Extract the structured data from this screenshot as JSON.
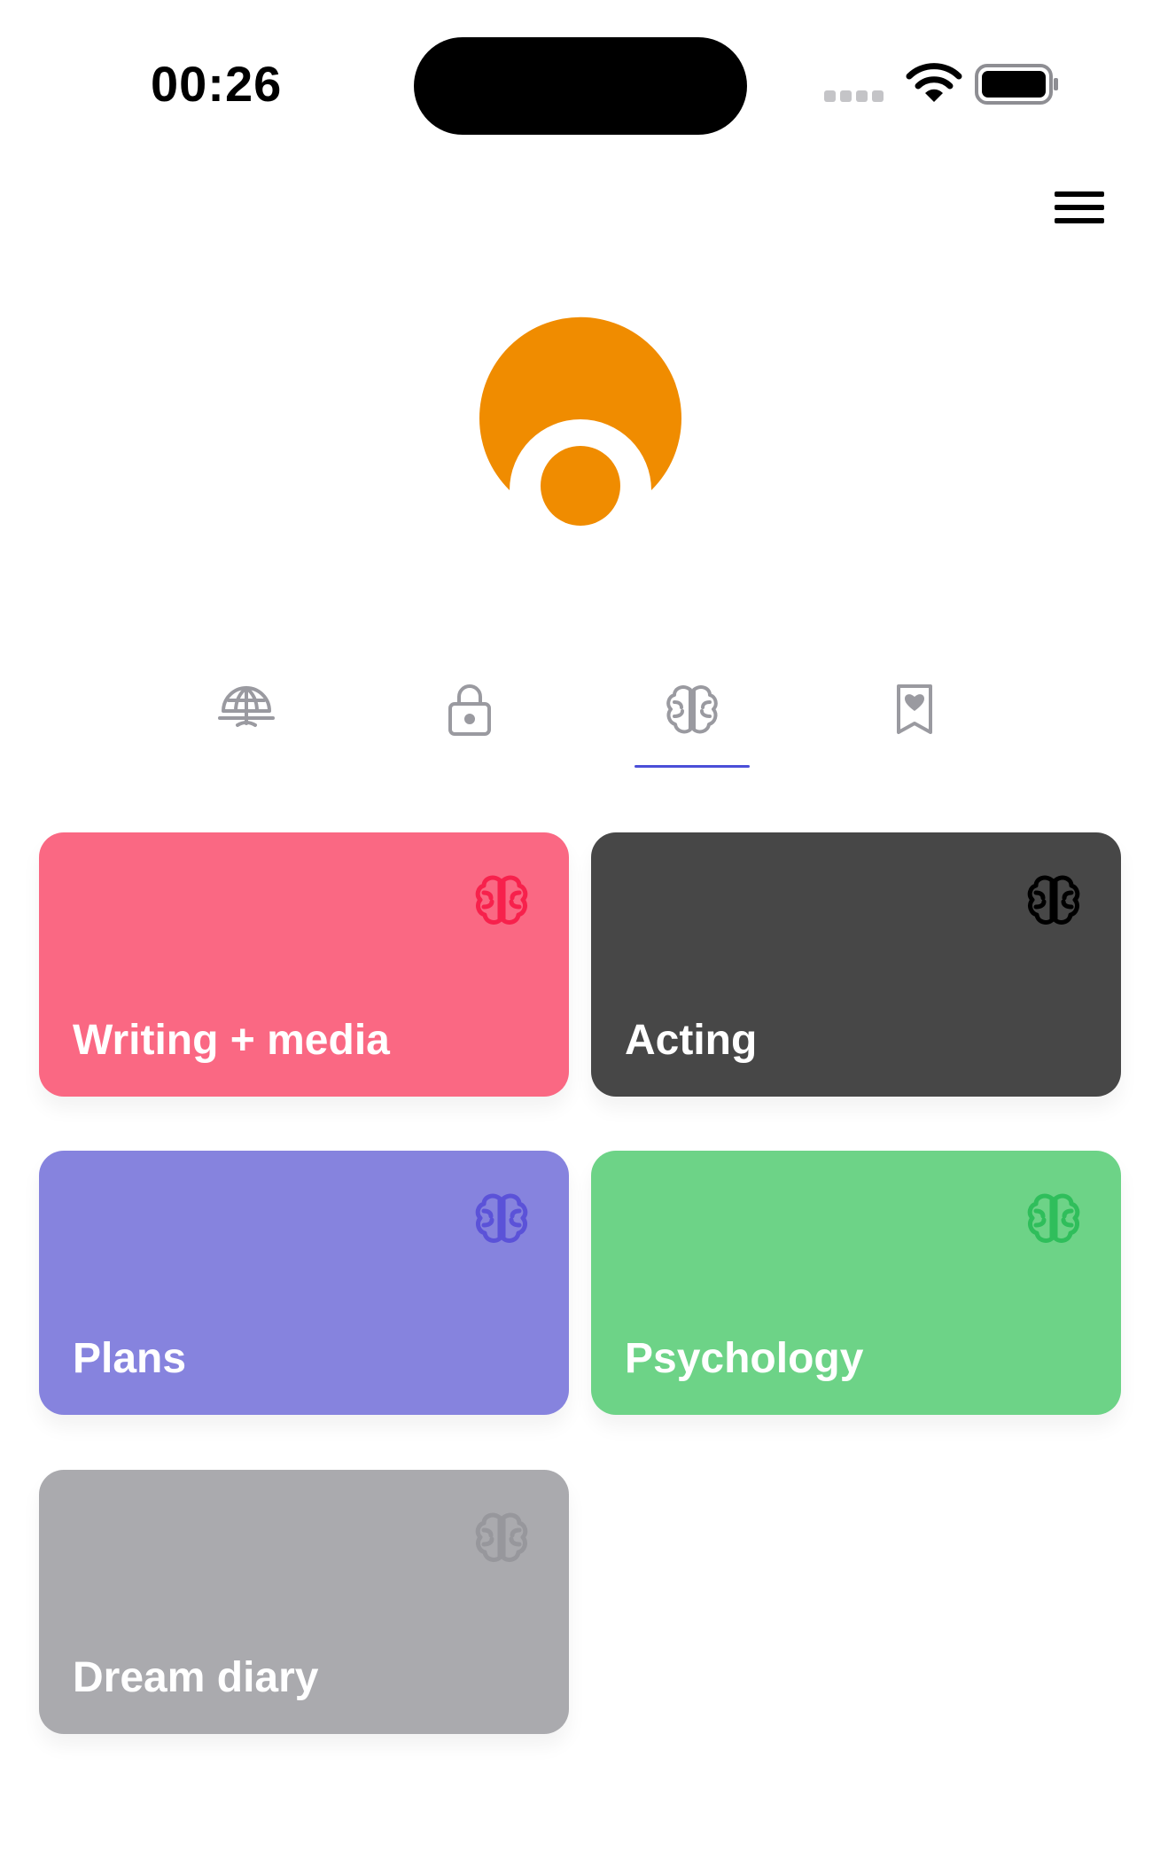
{
  "status_bar": {
    "time": "00:26"
  },
  "header": {
    "menu_icon": "hamburger-menu-icon"
  },
  "logo": {
    "color": "#F08C00",
    "icon": "app-logo"
  },
  "tabs": {
    "items": [
      {
        "icon": "umbrella-globe-icon",
        "active": false
      },
      {
        "icon": "lock-icon",
        "active": false
      },
      {
        "icon": "brain-icon",
        "active": true
      },
      {
        "icon": "bookmark-heart-icon",
        "active": false
      }
    ],
    "active_color": "#4B4FD8",
    "inactive_icon_color": "#9A9AA0"
  },
  "cards": [
    {
      "label": "Writing + media",
      "color": "#FA6883",
      "icon": "brain-icon",
      "icon_color": "#F7214C"
    },
    {
      "label": "Acting",
      "color": "#474747",
      "icon": "brain-icon",
      "icon_color": "#000000"
    },
    {
      "label": "Plans",
      "color": "#8683DE",
      "icon": "brain-icon",
      "icon_color": "#5B52D8"
    },
    {
      "label": "Psychology",
      "color": "#6DD387",
      "icon": "brain-icon",
      "icon_color": "#2FBE5B"
    },
    {
      "label": "Dream diary",
      "color": "#AAAAAE",
      "icon": "brain-icon",
      "icon_color": "#97979C"
    }
  ]
}
